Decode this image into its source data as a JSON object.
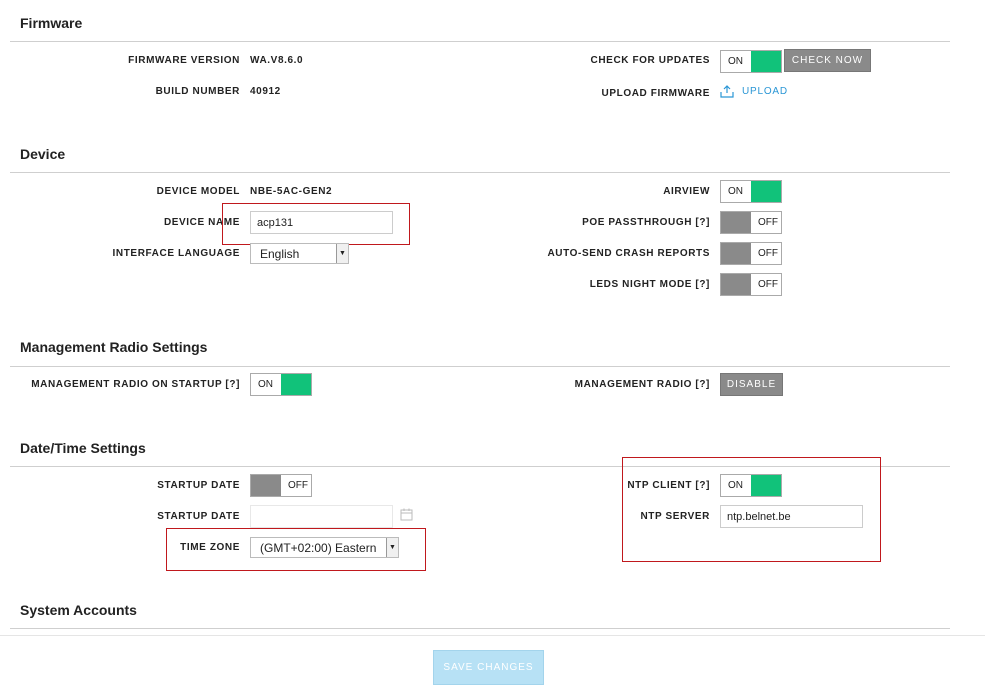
{
  "firmware": {
    "title": "Firmware",
    "firmware_version_label": "FIRMWARE VERSION",
    "firmware_version": "WA.V8.6.0",
    "build_number_label": "BUILD NUMBER",
    "build_number": "40912",
    "check_updates_label": "CHECK FOR UPDATES",
    "check_updates_state": "ON",
    "check_now_label": "CHECK NOW",
    "upload_firmware_label": "UPLOAD FIRMWARE",
    "upload_label": "UPLOAD"
  },
  "device": {
    "title": "Device",
    "model_label": "DEVICE MODEL",
    "model": "NBE-5AC-GEN2",
    "name_label": "DEVICE NAME",
    "name": "acp131",
    "language_label": "INTERFACE LANGUAGE",
    "language": "English",
    "airview_label": "AIRVIEW",
    "airview_state": "ON",
    "poe_label": "POE PASSTHROUGH [?]",
    "poe_state": "OFF",
    "crash_label": "AUTO-SEND CRASH REPORTS",
    "crash_state": "OFF",
    "leds_label": "LEDS NIGHT MODE [?]",
    "leds_state": "OFF"
  },
  "management": {
    "title": "Management Radio Settings",
    "startup_label": "MANAGEMENT RADIO ON STARTUP [?]",
    "startup_state": "ON",
    "radio_label": "MANAGEMENT RADIO [?]",
    "disable_label": "DISABLE"
  },
  "datetime": {
    "title": "Date/Time Settings",
    "startup_date_toggle_label": "STARTUP DATE",
    "startup_date_toggle_state": "OFF",
    "startup_date_label": "STARTUP DATE",
    "startup_date_value": "",
    "timezone_label": "TIME ZONE",
    "timezone": "(GMT+02:00) Eastern",
    "ntp_client_label": "NTP CLIENT [?]",
    "ntp_client_state": "ON",
    "ntp_server_label": "NTP SERVER",
    "ntp_server": "ntp.belnet.be"
  },
  "accounts": {
    "title": "System Accounts"
  },
  "footer": {
    "save_label": "SAVE CHANGES"
  },
  "colors": {
    "toggle_on": "#11c27a",
    "accent_link": "#2a96d5",
    "highlight_box": "#c0181d",
    "save_disabled": "#b7e1f5"
  }
}
